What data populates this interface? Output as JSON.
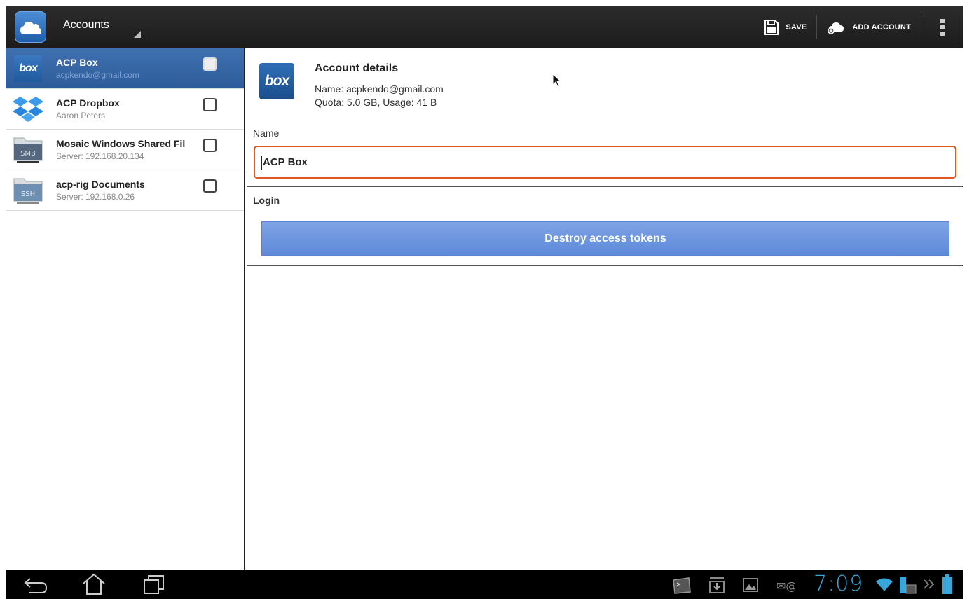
{
  "actionbar": {
    "title": "Accounts",
    "save_label": "SAVE",
    "add_account_label": "ADD ACCOUNT"
  },
  "accounts": [
    {
      "name": "ACP Box",
      "subtitle": "acpkendo@gmail.com",
      "icon": "box-icon",
      "selected": true
    },
    {
      "name": "ACP Dropbox",
      "subtitle": "Aaron Peters",
      "icon": "dropbox-icon",
      "selected": false
    },
    {
      "name": "Mosaic Windows Shared Fil",
      "subtitle": "Server: 192.168.20.134",
      "icon": "smb-folder-icon",
      "selected": false
    },
    {
      "name": "acp-rig Documents",
      "subtitle": "Server: 192.168.0.26",
      "icon": "ssh-folder-icon",
      "selected": false
    }
  ],
  "detail": {
    "logo_text": "box",
    "title": "Account details",
    "name_line": "Name: acpkendo@gmail.com",
    "quota_line": "Quota: 5.0 GB, Usage: 41 B",
    "name_label": "Name",
    "name_value": "ACP Box",
    "login_label": "Login",
    "destroy_label": "Destroy access tokens"
  },
  "system": {
    "time": "7:09"
  },
  "colors": {
    "accent_blue": "#6e97df",
    "selection": "#3a68a8",
    "focus_orange": "#e0581d",
    "clock_blue": "#38a7d8"
  }
}
